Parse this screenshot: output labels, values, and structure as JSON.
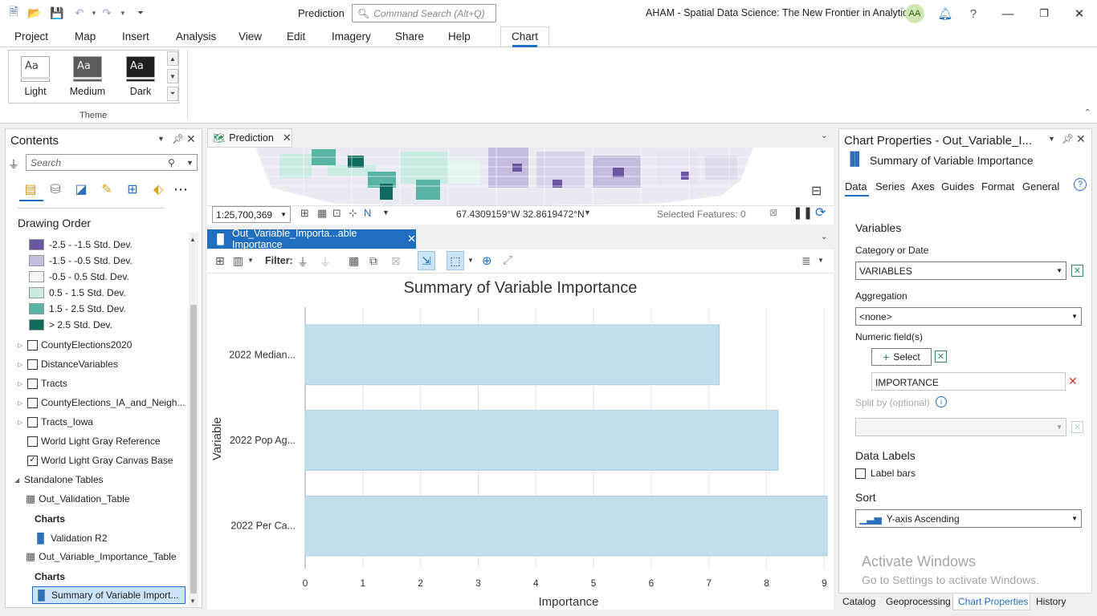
{
  "app": {
    "view_name": "Prediction",
    "command_search_placeholder": "Command Search (Alt+Q)",
    "project_title": "AHAM - Spatial Data Science:  The New Frontier in Analytics",
    "user_initials": "AA"
  },
  "menu": [
    "Project",
    "Map",
    "Insert",
    "Analysis",
    "View",
    "Edit",
    "Imagery",
    "Share",
    "Help",
    "Chart"
  ],
  "ribbon": {
    "themes": [
      "Light",
      "Medium",
      "Dark"
    ],
    "group_label": "Theme",
    "theme_sample": "Aa"
  },
  "contents": {
    "title": "Contents",
    "search_placeholder": "Search",
    "drawing_order_label": "Drawing Order",
    "legend": [
      {
        "label": "-2.5 - -1.5 Std. Dev.",
        "color": "#6b56a1"
      },
      {
        "label": "-1.5 - -0.5 Std. Dev.",
        "color": "#c5bde0"
      },
      {
        "label": "-0.5 - 0.5 Std. Dev.",
        "color": "#f6f6f6"
      },
      {
        "label": "0.5 - 1.5 Std. Dev.",
        "color": "#c9ebe2"
      },
      {
        "label": "1.5 - 2.5 Std. Dev.",
        "color": "#58b4a5"
      },
      {
        "label": "> 2.5 Std. Dev.",
        "color": "#0f6b5e"
      }
    ],
    "layers": [
      {
        "name": "CountyElections2020",
        "expandable": true,
        "checked": false
      },
      {
        "name": "DistanceVariables",
        "expandable": true,
        "checked": false
      },
      {
        "name": "Tracts",
        "expandable": true,
        "checked": false
      },
      {
        "name": "CountyElections_IA_and_Neigh...",
        "expandable": true,
        "checked": false
      },
      {
        "name": "Tracts_Iowa",
        "expandable": true,
        "checked": false
      },
      {
        "name": "World Light Gray Reference",
        "expandable": false,
        "checked": false
      },
      {
        "name": "World Light Gray Canvas Base",
        "expandable": false,
        "checked": true
      }
    ],
    "standalone_tables_label": "Standalone Tables",
    "tables": [
      {
        "name": "Out_Validation_Table",
        "charts_label": "Charts",
        "chart": "Validation R2"
      },
      {
        "name": "Out_Variable_Importance_Table",
        "charts_label": "Charts",
        "chart": "Summary of Variable Import..."
      }
    ]
  },
  "map": {
    "tab_label": "Prediction",
    "scale": "1:25,700,369",
    "coordinates": "67.4309159°W 32.8619472°N",
    "selected_features": "Selected Features: 0"
  },
  "chart_view": {
    "tab_label": "Out_Variable_Importa...able Importance",
    "filter_label": "Filter:"
  },
  "chart_data": {
    "type": "bar",
    "orientation": "horizontal",
    "title": "Summary of Variable Importance",
    "xlabel": "Importance",
    "ylabel": "Variable",
    "categories": [
      "2022 Median...",
      "2022 Pop Ag...",
      "2022 Per Ca..."
    ],
    "values": [
      7.18,
      8.2,
      9.05
    ],
    "xlim": [
      0,
      9.05
    ],
    "xticks": [
      "0",
      "1",
      "2",
      "3",
      "4",
      "5",
      "6",
      "7",
      "8",
      "9"
    ],
    "grid": true,
    "bar_color": "#c3deed"
  },
  "properties": {
    "title": "Chart Properties - Out_Variable_I...",
    "chart_name": "Summary of Variable Importance",
    "tabs": [
      "Data",
      "Series",
      "Axes",
      "Guides",
      "Format",
      "General"
    ],
    "variables_header": "Variables",
    "category_label": "Category or Date",
    "category_value": "VARIABLES",
    "aggregation_label": "Aggregation",
    "aggregation_value": "<none>",
    "numeric_label": "Numeric field(s)",
    "select_button": "Select",
    "numeric_value": "IMPORTANCE",
    "split_label": "Split by (optional)",
    "data_labels_header": "Data Labels",
    "label_bars": "Label bars",
    "sort_header": "Sort",
    "sort_value": "Y-axis Ascending"
  },
  "bottom_tabs": [
    "Catalog",
    "Geoprocessing",
    "Chart Properties",
    "History"
  ],
  "watermark": {
    "line1": "Activate Windows",
    "line2": "Go to Settings to activate Windows."
  }
}
